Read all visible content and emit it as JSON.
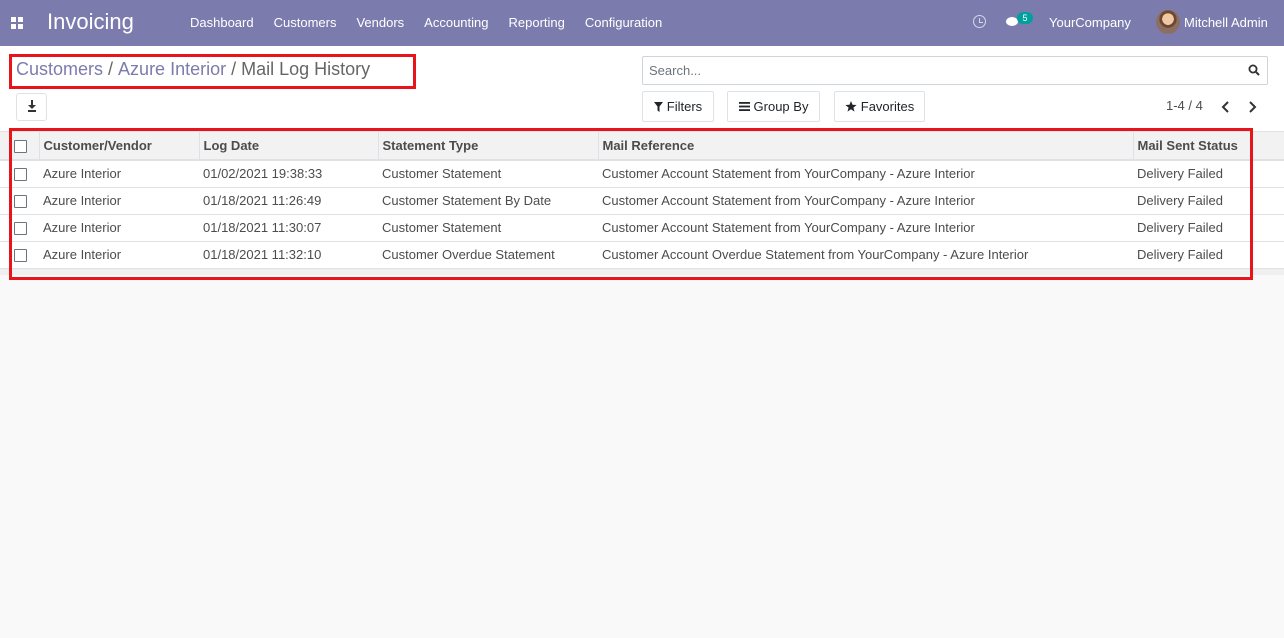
{
  "navbar": {
    "app_title": "Invoicing",
    "menu": [
      "Dashboard",
      "Customers",
      "Vendors",
      "Accounting",
      "Reporting",
      "Configuration"
    ],
    "chat_badge": "5",
    "company": "YourCompany",
    "user": "Mitchell Admin"
  },
  "breadcrumb": {
    "items": [
      "Customers",
      "Azure Interior",
      "Mail Log History"
    ],
    "separator": "/"
  },
  "search": {
    "placeholder": "Search..."
  },
  "buttons": {
    "filters": "Filters",
    "group_by": "Group By",
    "favorites": "Favorites"
  },
  "pager": {
    "text": "1-4 / 4"
  },
  "table": {
    "columns": [
      "Customer/Vendor",
      "Log Date",
      "Statement Type",
      "Mail Reference",
      "Mail Sent Status"
    ],
    "rows": [
      {
        "customer": "Azure Interior",
        "log_date": "01/02/2021 19:38:33",
        "statement_type": "Customer Statement",
        "mail_reference": "Customer Account Statement from YourCompany - Azure Interior",
        "status": "Delivery Failed"
      },
      {
        "customer": "Azure Interior",
        "log_date": "01/18/2021 11:26:49",
        "statement_type": "Customer Statement By Date",
        "mail_reference": "Customer Account Statement from YourCompany - Azure Interior",
        "status": "Delivery Failed"
      },
      {
        "customer": "Azure Interior",
        "log_date": "01/18/2021 11:30:07",
        "statement_type": "Customer Statement",
        "mail_reference": "Customer Account Statement from YourCompany - Azure Interior",
        "status": "Delivery Failed"
      },
      {
        "customer": "Azure Interior",
        "log_date": "01/18/2021 11:32:10",
        "statement_type": "Customer Overdue Statement",
        "mail_reference": "Customer Account Overdue Statement from YourCompany - Azure Interior",
        "status": "Delivery Failed"
      }
    ]
  },
  "icons": {
    "apps": "apps-grid-icon",
    "activity": "clock-icon",
    "messages": "chat-icon",
    "download": "download-icon",
    "search": "search-icon",
    "filter": "filter-icon",
    "group_by": "bars-icon",
    "favorites": "star-icon",
    "pager_prev": "chevron-left-icon",
    "pager_next": "chevron-right-icon"
  },
  "colors": {
    "navbar": "#7c7bad",
    "link": "#7c7bad",
    "badge": "#00a09d",
    "highlight": "#e8141c"
  }
}
